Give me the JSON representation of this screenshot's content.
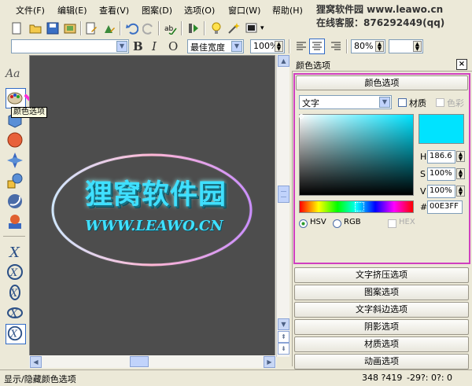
{
  "menu": [
    "文件(F)",
    "编辑(E)",
    "查看(V)",
    "图案(D)",
    "选项(O)",
    "窗口(W)",
    "帮助(H)"
  ],
  "brand": {
    "line1": "狸窝软件园 www.leawo.cn",
    "line2": "在线客服：876292449(qq)"
  },
  "toolbar2": {
    "font": "",
    "bold": "B",
    "italic": "I",
    "outline": "O",
    "width_mode": "最佳宽度",
    "zoom": "100%",
    "line_spacing": "80%"
  },
  "canvas": {
    "title": "狸窝软件园",
    "subtitle": "WWW.LEAWO.CN"
  },
  "tooltip": "颜色选项",
  "panel": {
    "title": "颜色选项",
    "section_button": "颜色选项",
    "target": "文字",
    "material_label": "材质",
    "color_label": "色彩",
    "h_label": "H",
    "h_value": "186.6",
    "s_label": "S",
    "s_value": "100%",
    "v_label": "V",
    "v_value": "100%",
    "hex_label": "#",
    "hex_value": "00E3FF",
    "hsv_label": "HSV",
    "rgb_label": "RGB",
    "hex_mode_label": "HEX",
    "preview_color": "#00e3ff",
    "sections": [
      "文字挤压选项",
      "图案选项",
      "文字斜边选项",
      "阴影选项",
      "材质选项",
      "动画选项"
    ]
  },
  "status": {
    "left": "显示/隐藏颜色选项",
    "coords": "348 ?419",
    "extra": "-29?: 0?: 0"
  }
}
